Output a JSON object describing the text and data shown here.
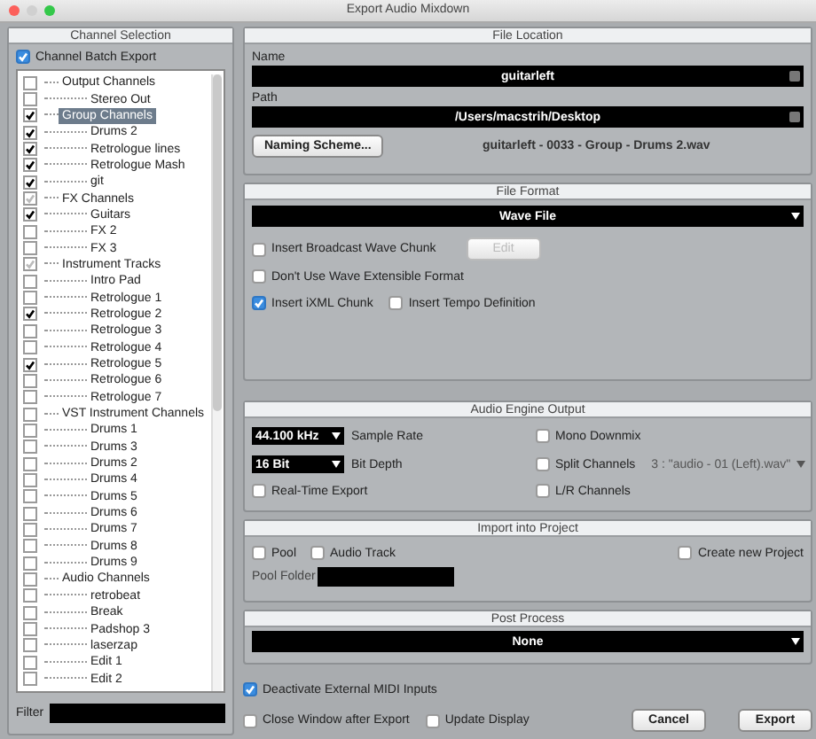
{
  "window": {
    "title": "Export Audio Mixdown"
  },
  "channel_selection": {
    "title": "Channel Selection",
    "batch_export": {
      "label": "Channel Batch Export",
      "checked": true
    },
    "tree": [
      {
        "label": "Output Channels",
        "checked": false,
        "selected": false,
        "children": [
          {
            "label": "Stereo Out",
            "checked": false,
            "selected": false
          }
        ]
      },
      {
        "label": "Group Channels",
        "checked": true,
        "selected": true,
        "children": [
          {
            "label": "Drums 2",
            "checked": true,
            "selected": false
          },
          {
            "label": "Retrologue lines",
            "checked": true,
            "selected": false
          },
          {
            "label": "Retrologue Mash",
            "checked": true,
            "selected": false
          },
          {
            "label": "git",
            "checked": true,
            "selected": false
          }
        ]
      },
      {
        "label": "FX Channels",
        "checked": true,
        "mixed": true,
        "selected": false,
        "children": [
          {
            "label": "Guitars",
            "checked": true,
            "selected": false
          },
          {
            "label": "FX 2",
            "checked": false,
            "selected": false
          },
          {
            "label": "FX 3",
            "checked": false,
            "selected": false
          }
        ]
      },
      {
        "label": "Instrument Tracks",
        "checked": true,
        "mixed": true,
        "selected": false,
        "children": [
          {
            "label": "Intro Pad",
            "checked": false,
            "selected": false
          },
          {
            "label": "Retrologue 1",
            "checked": false,
            "selected": false
          },
          {
            "label": "Retrologue 2",
            "checked": true,
            "selected": false
          },
          {
            "label": "Retrologue 3",
            "checked": false,
            "selected": false
          },
          {
            "label": "Retrologue 4",
            "checked": false,
            "selected": false
          },
          {
            "label": "Retrologue 5",
            "checked": true,
            "selected": false
          },
          {
            "label": "Retrologue 6",
            "checked": false,
            "selected": false
          },
          {
            "label": "Retrologue 7",
            "checked": false,
            "selected": false
          }
        ]
      },
      {
        "label": "VST Instrument Channels",
        "checked": false,
        "selected": false,
        "children": [
          {
            "label": "Drums 1",
            "checked": false,
            "selected": false
          },
          {
            "label": "Drums 3",
            "checked": false,
            "selected": false
          },
          {
            "label": "Drums 2",
            "checked": false,
            "selected": false
          },
          {
            "label": "Drums 4",
            "checked": false,
            "selected": false
          },
          {
            "label": "Drums 5",
            "checked": false,
            "selected": false
          },
          {
            "label": "Drums 6",
            "checked": false,
            "selected": false
          },
          {
            "label": "Drums 7",
            "checked": false,
            "selected": false
          },
          {
            "label": "Drums 8",
            "checked": false,
            "selected": false
          },
          {
            "label": "Drums 9",
            "checked": false,
            "selected": false
          }
        ]
      },
      {
        "label": "Audio Channels",
        "checked": false,
        "selected": false,
        "children": [
          {
            "label": "retrobeat",
            "checked": false,
            "selected": false
          },
          {
            "label": "Break",
            "checked": false,
            "selected": false
          },
          {
            "label": "Padshop 3",
            "checked": false,
            "selected": false
          },
          {
            "label": "laserzap",
            "checked": false,
            "selected": false
          },
          {
            "label": "Edit 1",
            "checked": false,
            "selected": false
          },
          {
            "label": "Edit 2",
            "checked": false,
            "selected": false
          }
        ]
      }
    ],
    "filter_label": "Filter"
  },
  "file_location": {
    "title": "File Location",
    "name_label": "Name",
    "name_value": "guitarleft",
    "path_label": "Path",
    "path_value": "/Users/macstrih/Desktop",
    "naming_button": "Naming Scheme...",
    "preview": "guitarleft - 0033 - Group - Drums 2.wav"
  },
  "file_format": {
    "title": "File Format",
    "format": "Wave File",
    "broadcast": {
      "label": "Insert Broadcast Wave Chunk",
      "checked": false
    },
    "edit_button": {
      "label": "Edit",
      "disabled": true
    },
    "extensible": {
      "label": "Don't Use Wave Extensible Format",
      "checked": false
    },
    "ixml": {
      "label": "Insert iXML Chunk",
      "checked": true
    },
    "tempo": {
      "label": "Insert Tempo Definition",
      "checked": false
    }
  },
  "audio_engine_output": {
    "title": "Audio Engine Output",
    "sample_rate": {
      "value": "44.100 kHz",
      "label": "Sample Rate"
    },
    "bit_depth": {
      "value": "16 Bit",
      "label": "Bit Depth"
    },
    "real_time_export": {
      "label": "Real-Time Export",
      "checked": false
    },
    "mono_downmix": {
      "label": "Mono Downmix",
      "checked": false
    },
    "split_channels": {
      "label": "Split Channels",
      "checked": false,
      "value": "3 : \"audio - 01 (Left).wav\""
    },
    "lr_channels": {
      "label": "L/R Channels",
      "checked": false
    }
  },
  "import_into_project": {
    "title": "Import into Project",
    "pool": {
      "label": "Pool",
      "checked": false
    },
    "audio_track": {
      "label": "Audio Track",
      "checked": false
    },
    "create_new_project": {
      "label": "Create new Project",
      "checked": false
    },
    "pool_folder_label": "Pool Folder"
  },
  "post_process": {
    "title": "Post Process",
    "value": "None"
  },
  "deactivate_midi": {
    "label": "Deactivate External MIDI Inputs",
    "checked": true
  },
  "close_window": {
    "label": "Close Window after Export",
    "checked": false
  },
  "update_display": {
    "label": "Update Display",
    "checked": false
  },
  "buttons": [
    "Cancel",
    "Export"
  ]
}
